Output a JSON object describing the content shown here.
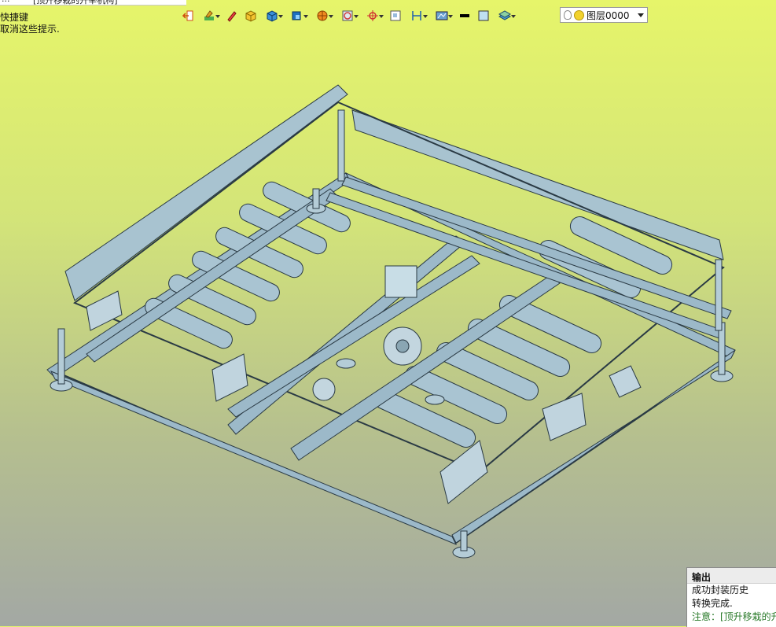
{
  "top_tabs": [
    "...",
    "[顶升移栽的升举机构]"
  ],
  "hints": [
    "快捷键",
    "取消这些提示."
  ],
  "toolbar": {
    "icons": [
      "exit-icon",
      "paint-icon",
      "pencil-icon",
      "box-icon",
      "cube-icon",
      "cube-view-icon",
      "sphere-icon",
      "circle-target-icon",
      "crosshair-icon",
      "grid-icon",
      "dimension-icon",
      "screen-icon",
      "line-icon",
      "square-icon",
      "layer-stack-icon"
    ]
  },
  "layer_select": {
    "value": "图层0000"
  },
  "output_panel": {
    "title": "输出",
    "lines": [
      "成功封装历史",
      "转换完成.",
      "注意：[顶升移栽的升举机构]"
    ]
  },
  "colors": {
    "model_fill": "#9cb9c9",
    "model_stroke": "#2a3a44",
    "background_top": "#e6f56a",
    "background_bottom": "#a3a8a4"
  }
}
